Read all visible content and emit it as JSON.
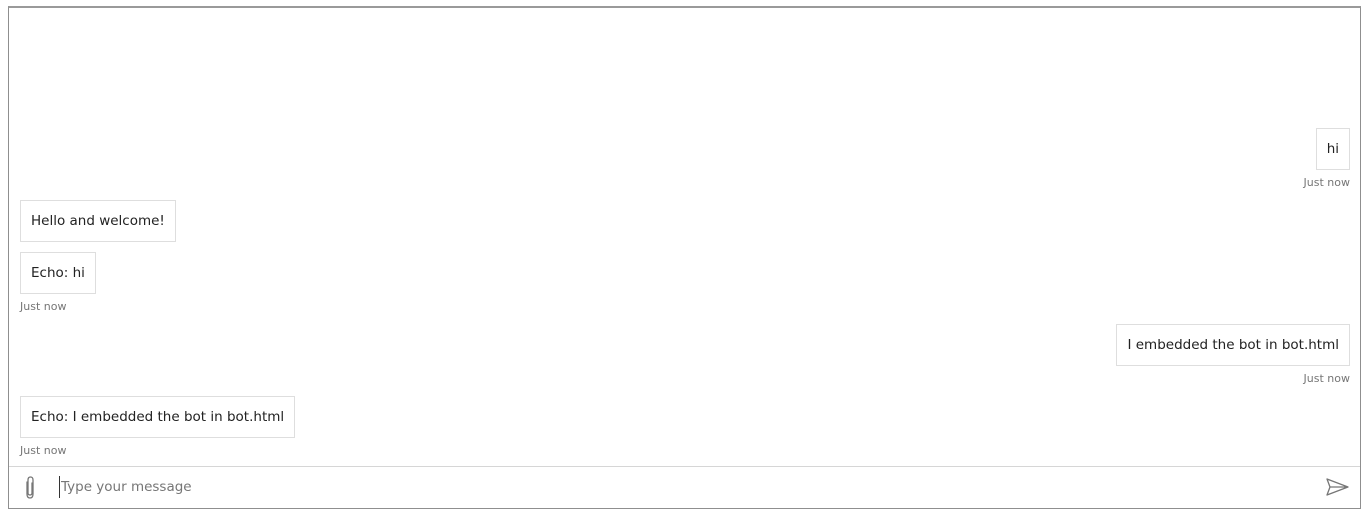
{
  "transcript": {
    "messages": [
      {
        "from": "user",
        "text": "hi",
        "timestamp": "Just now"
      },
      {
        "from": "bot",
        "text": "Hello and welcome!"
      },
      {
        "from": "bot",
        "text": "Echo: hi",
        "timestamp": "Just now"
      },
      {
        "from": "user",
        "text": "I embedded the bot in bot.html",
        "timestamp": "Just now"
      },
      {
        "from": "bot",
        "text": "Echo: I embedded the bot in bot.html",
        "timestamp": "Just now"
      }
    ]
  },
  "send_box": {
    "placeholder": "Type your message",
    "attach_icon": "paperclip-icon",
    "send_icon": "send-icon"
  },
  "colors": {
    "frame_border": "#8f8f8f",
    "bubble_border": "#dedede",
    "timestamp_text": "#767676",
    "icon": "#767676"
  }
}
